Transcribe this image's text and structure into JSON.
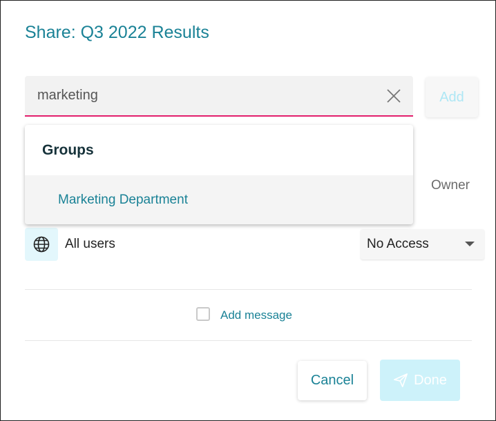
{
  "dialog": {
    "title": "Share: Q3 2022 Results"
  },
  "search": {
    "value": "marketing",
    "clear_icon": "close-icon"
  },
  "add_button": {
    "label": "Add"
  },
  "dropdown": {
    "group_header": "Groups",
    "options": [
      {
        "label": "Marketing Department"
      }
    ]
  },
  "permissions": {
    "owner_label": "Owner",
    "all_users": {
      "icon": "globe-icon",
      "label": "All users",
      "access": "No Access"
    }
  },
  "message": {
    "checkbox_checked": false,
    "label": "Add message"
  },
  "footer": {
    "cancel_label": "Cancel",
    "done_label": "Done",
    "done_icon": "send-icon"
  },
  "colors": {
    "accent": "#1a8296",
    "focus_underline": "#e21d6c",
    "disabled_button": "#cdf2fa"
  }
}
